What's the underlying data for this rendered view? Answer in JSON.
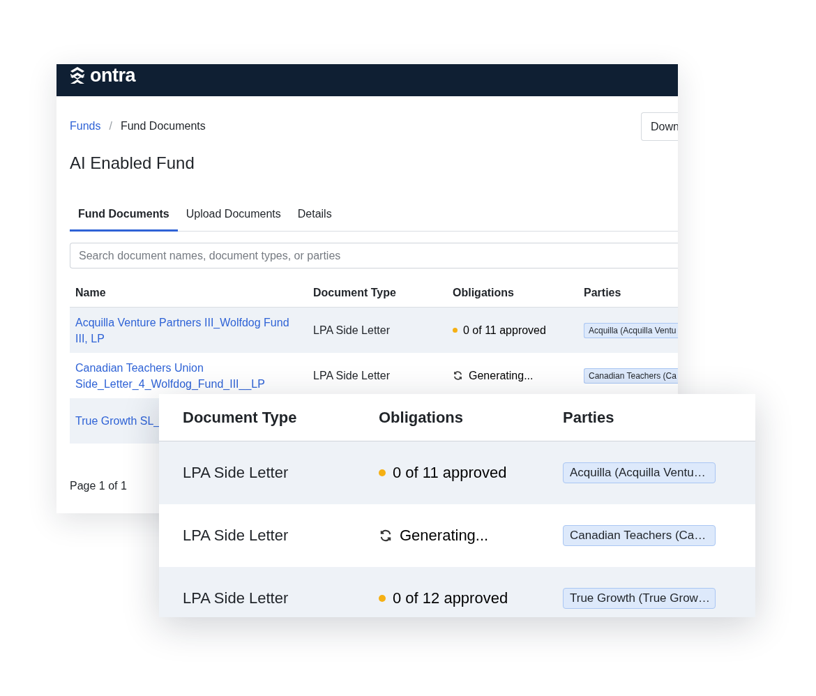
{
  "back_window": {
    "logo": "ontra",
    "breadcrumbs": [
      {
        "label": "Funds",
        "kind": "link"
      },
      {
        "label": "Fund Documents",
        "kind": "current"
      }
    ],
    "breadcrumb_separator": "/",
    "title": "AI Enabled Fund",
    "download_button": "Down",
    "tabs": [
      {
        "label": "Fund Documents",
        "selected": true
      },
      {
        "label": "Upload Documents",
        "selected": false
      },
      {
        "label": "Details",
        "selected": false
      }
    ],
    "search": {
      "placeholder": "Search document names, document types, or parties"
    },
    "table": {
      "columns": [
        "Name",
        "Document Type",
        "Obligations",
        "Parties"
      ],
      "rows": [
        {
          "name": "Acquilla Venture Partners III_Wolfdog Fund III, LP",
          "document_type": "LPA Side Letter",
          "kind": "pending",
          "obligations": "0 of 11 approved",
          "party": "Acquilla (Acquilla Ventu"
        },
        {
          "name": "Canadian Teachers Union Side_Letter_4_Wolfdog_Fund_III__LP",
          "document_type": "LPA Side Letter",
          "kind": "generating",
          "obligations": "Generating...",
          "party": "Canadian Teachers (Ca"
        },
        {
          "name": "True Growth SL_"
        }
      ]
    },
    "pagination": "Page 1 of 1"
  },
  "zoom_panel": {
    "columns": [
      "Document Type",
      "Obligations",
      "Parties"
    ],
    "rows": [
      {
        "document_type": "LPA Side Letter",
        "kind": "pending",
        "obligations": "0 of 11 approved",
        "party": "Acquilla (Acquilla Ventu…"
      },
      {
        "document_type": "LPA Side Letter",
        "kind": "generating",
        "obligations": "Generating...",
        "party": "Canadian Teachers (Ca…"
      },
      {
        "document_type": "LPA Side Letter",
        "kind": "pending",
        "obligations": "0 of 12 approved",
        "party": "True Growth (True Grow…"
      }
    ]
  }
}
